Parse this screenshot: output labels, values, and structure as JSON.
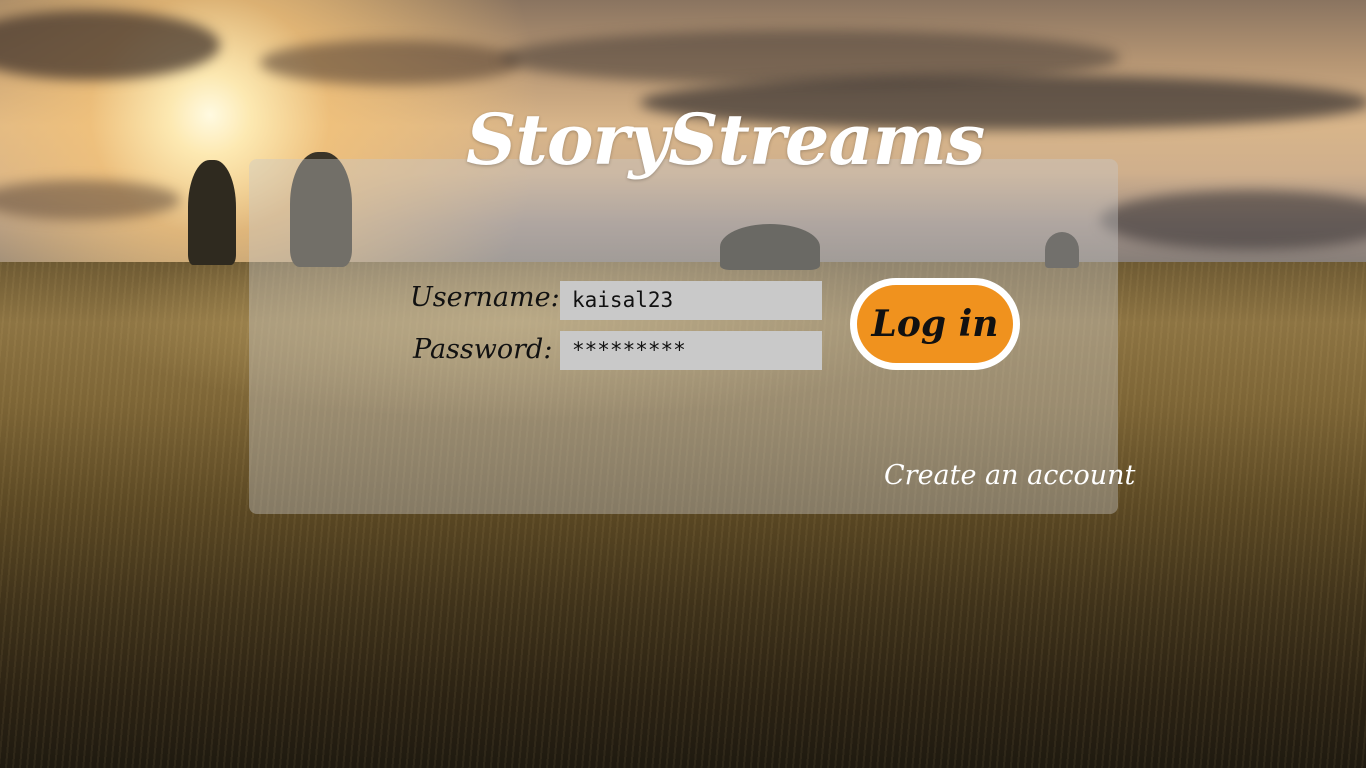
{
  "app": {
    "title": "StoryStreams"
  },
  "login_form": {
    "username_label": "Username:",
    "username_value": "kaisal23",
    "password_label": "Password:",
    "password_value": "*********",
    "login_button_label": "Log in",
    "create_account_label": "Create an account"
  },
  "colors": {
    "accent": "#f0921e",
    "panel": "#c8c8c8",
    "input_background": "#c9c9c9",
    "title_text": "#ffffff"
  }
}
